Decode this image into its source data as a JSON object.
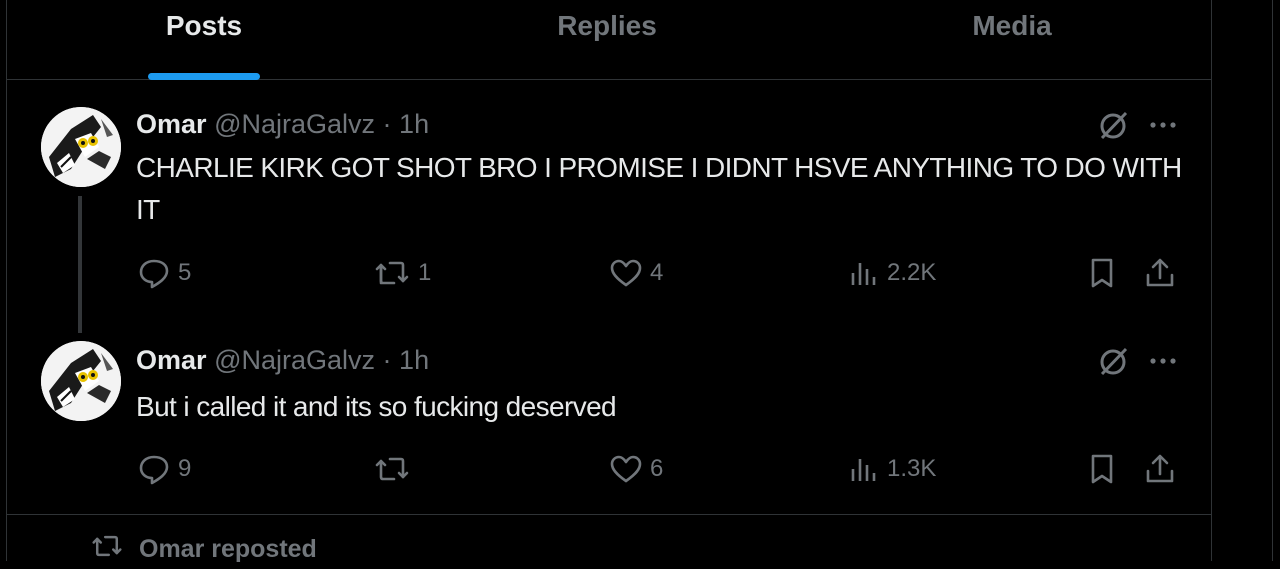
{
  "tabs": [
    {
      "label": "Posts",
      "active": true
    },
    {
      "label": "Replies",
      "active": false
    },
    {
      "label": "Media",
      "active": false
    }
  ],
  "colors": {
    "accent": "#1d9bf0",
    "muted": "#71767b",
    "text": "#e7e9ea",
    "border": "#2f3336"
  },
  "posts": [
    {
      "name": "Omar",
      "handle": "@NajraGalvz",
      "separator": "·",
      "time": "1h",
      "text": "CHARLIE KIRK GOT SHOT BRO I PROMISE I DIDNT HSVE ANYTHING TO DO WITH IT",
      "replies": "5",
      "reposts": "1",
      "likes": "4",
      "views": "2.2K"
    },
    {
      "name": "Omar",
      "handle": "@NajraGalvz",
      "separator": "·",
      "time": "1h",
      "text": "But i called it and its so fucking deserved",
      "replies": "9",
      "reposts": "",
      "likes": "6",
      "views": "1.3K"
    }
  ],
  "repost_indicator": {
    "label": "Omar reposted"
  },
  "icons": [
    "grok-icon",
    "more-icon",
    "reply-icon",
    "repost-icon",
    "like-icon",
    "views-icon",
    "bookmark-icon",
    "share-icon"
  ]
}
